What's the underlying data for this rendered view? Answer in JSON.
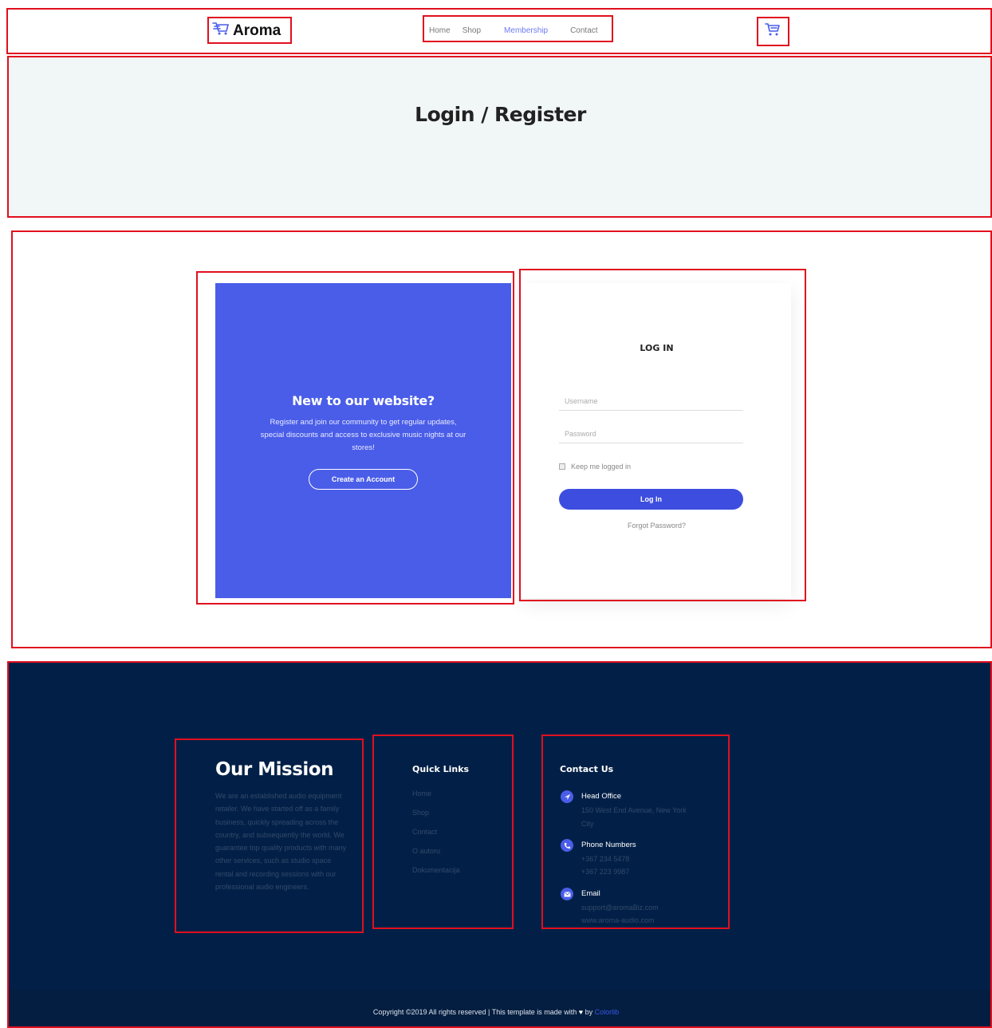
{
  "header": {
    "logo_text": "Aroma",
    "nav": [
      "Home",
      "Shop",
      "Membership",
      "Contact"
    ],
    "active_nav": "Membership",
    "cart_icon": "cart-icon"
  },
  "banner": {
    "title": "Login / Register"
  },
  "register": {
    "title": "New to our website?",
    "text": "Register and join our community to get regular updates, special discounts and access to exclusive music nights at our stores!",
    "button": "Create an Account"
  },
  "login": {
    "title": "LOG IN",
    "username_placeholder": "Username",
    "password_placeholder": "Password",
    "keep_label": "Keep me logged in",
    "button": "Log In",
    "forgot": "Forgot Password?"
  },
  "footer": {
    "mission": {
      "title": "Our Mission",
      "text": "We are an established audio equipment retailer. We have started off as a family business, quickly spreading across the country, and subsequently the world. We guarantee top quality products with many other services, such as studio space rental and recording sessions with our professional audio engineers."
    },
    "quick_links": {
      "title": "Quick Links",
      "items": [
        "Home",
        "Shop",
        "Contact",
        "O autoru",
        "Dokumentacija"
      ]
    },
    "contact": {
      "title": "Contact Us",
      "head_office_label": "Head Office",
      "head_office_value": "150 West End Avenue, New York City",
      "phone_label": "Phone Numbers",
      "phone_1": "+367 234 5478",
      "phone_2": "+367 223 9987",
      "email_label": "Email",
      "email_1": "support@aromaBiz.com",
      "email_2": "www.aroma-audio.com"
    },
    "copyright_prefix": "Copyright ©2019 All rights reserved | This template is made with",
    "copyright_by": "by",
    "copyright_credit": "Colorlib"
  },
  "colors": {
    "accent": "#4a5de8",
    "footer_bg": "#022047",
    "banner_bg": "#f1f6f7",
    "highlight_box": "#e0101e"
  }
}
